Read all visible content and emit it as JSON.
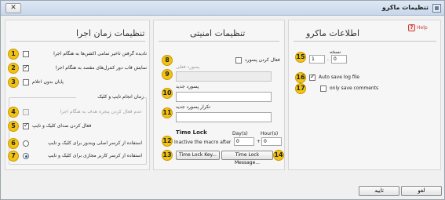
{
  "window": {
    "title": "تنظیمات ماکرو",
    "close_label": "✕"
  },
  "badges": [
    "1",
    "2",
    "3",
    "4",
    "5",
    "6",
    "7",
    "8",
    "9",
    "10",
    "11",
    "12",
    "13",
    "14",
    "15",
    "16",
    "17"
  ],
  "execution": {
    "title": "تنظیمات زمان اجرا",
    "option1": "نادیده گرفتن تاخیر تمامی اکشن‌ها به هنگام اجرا",
    "option2": "نمایش قاب دور کنترل‌های مقصد به هنگام اجرا",
    "option3": "پایان بدون اعلام",
    "group_title": "زمان انجام تایپ و کلیک",
    "option4": "عدم فعال کردن پنجره هدف به هنگام اجرا",
    "option5": "فعال کردن صدای کلیک و تایپ",
    "radio1": "استفاده از کرسر اصلی ویندوز برای کلیک و تایپ",
    "radio2": "استفاده از کرسر کاربر مجازی برای کلیک و تایپ"
  },
  "security": {
    "title": "تنظیمات امنیتی",
    "enable_password": "فعال کردن پسورد",
    "current_password_label": "پسورد فعلی",
    "new_password_label": "پسورد جدید",
    "repeat_password_label": "تکرار پسورد جدید",
    "time_lock_title": "Time Lock",
    "days_label": "Day(s)",
    "hours_label": "Hour(s)",
    "inactive_label": "Inactive the macro after",
    "days_value": "0",
    "hours_value": "0",
    "plus": "+",
    "time_lock_key": "Time Lock Key...",
    "time_lock_message": "Time Lock Message..."
  },
  "macro_info": {
    "title": "اطلاعات ماکرو",
    "help": "Help",
    "version_label": "نسخه",
    "version_major": "1",
    "version_minor": "0",
    "dot": ".",
    "auto_save_log": "Auto save log file",
    "only_save_comments": "only save comments"
  },
  "footer": {
    "ok": "تایید",
    "cancel": "لغو"
  }
}
